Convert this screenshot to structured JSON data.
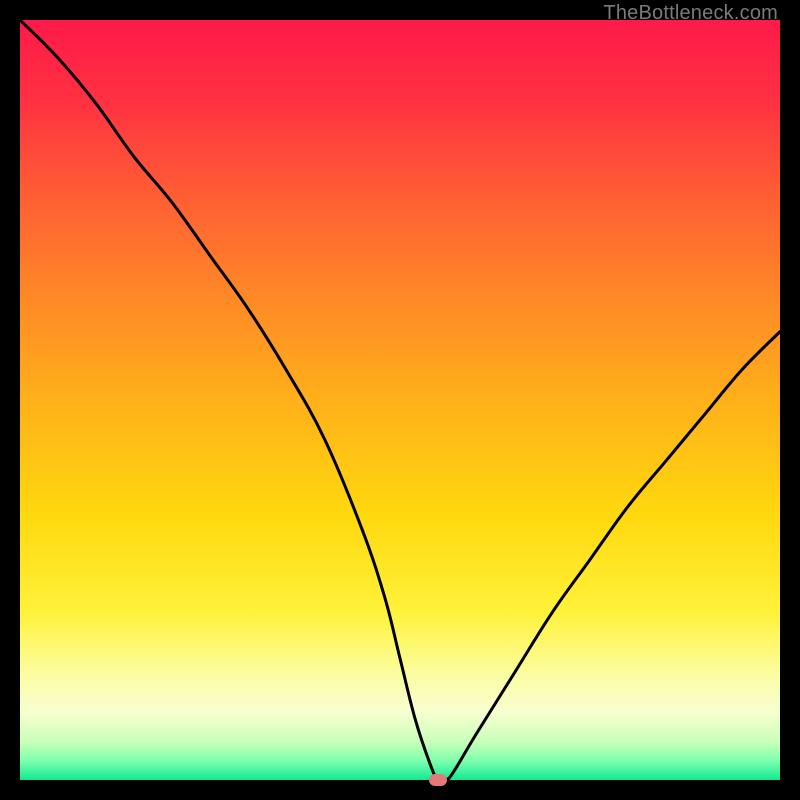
{
  "watermark": "TheBottleneck.com",
  "colors": {
    "bg": "#000000",
    "gradient_stops": [
      {
        "offset": 0.0,
        "color": "#ff1a49"
      },
      {
        "offset": 0.1,
        "color": "#ff2f42"
      },
      {
        "offset": 0.22,
        "color": "#ff5a35"
      },
      {
        "offset": 0.35,
        "color": "#ff8428"
      },
      {
        "offset": 0.5,
        "color": "#ffb01a"
      },
      {
        "offset": 0.65,
        "color": "#ffd80e"
      },
      {
        "offset": 0.78,
        "color": "#fff23a"
      },
      {
        "offset": 0.86,
        "color": "#fcfda0"
      },
      {
        "offset": 0.91,
        "color": "#f7ffd0"
      },
      {
        "offset": 0.95,
        "color": "#c9ffb8"
      },
      {
        "offset": 0.975,
        "color": "#7dffae"
      },
      {
        "offset": 1.0,
        "color": "#11e991"
      }
    ],
    "curve": "#000000",
    "marker": "#e27a78"
  },
  "chart_data": {
    "type": "line",
    "title": "",
    "xlabel": "",
    "ylabel": "",
    "xlim": [
      0,
      100
    ],
    "ylim": [
      0,
      100
    ],
    "marker": {
      "x": 55,
      "y": 0
    },
    "series": [
      {
        "name": "bottleneck-curve",
        "x": [
          0,
          5,
          10,
          15,
          20,
          25,
          30,
          35,
          40,
          45,
          48,
          50,
          52,
          54,
          55,
          56,
          57,
          60,
          65,
          70,
          75,
          80,
          85,
          90,
          95,
          100
        ],
        "y": [
          100,
          95,
          89,
          82,
          76,
          69,
          62,
          54,
          45,
          33,
          24,
          16,
          8,
          2,
          0,
          0,
          1,
          6,
          14,
          22,
          29,
          36,
          42,
          48,
          54,
          59
        ]
      }
    ]
  }
}
